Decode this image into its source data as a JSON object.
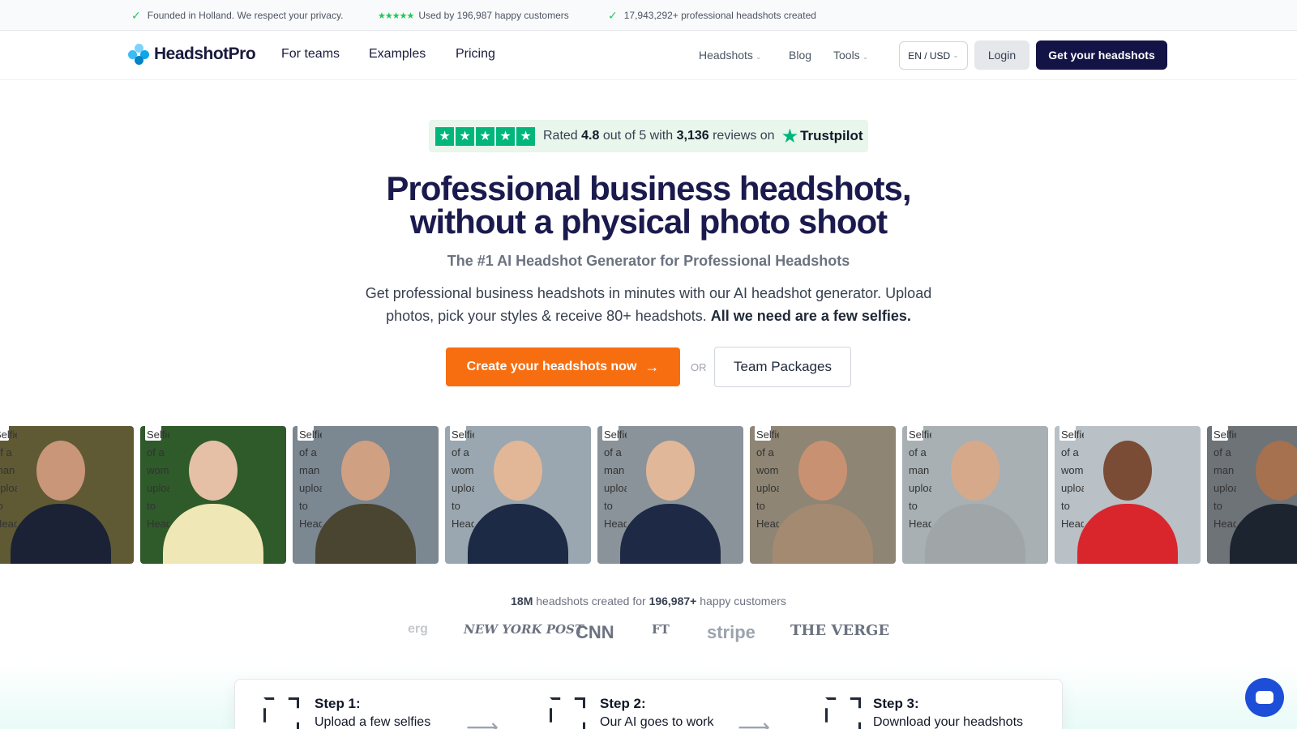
{
  "topbar": {
    "items": [
      "Founded in Holland. We respect your privacy.",
      "Used by 196,987 happy customers",
      "17,943,292+ professional headshots created"
    ]
  },
  "nav": {
    "brand": "HeadshotPro",
    "links": [
      "For teams",
      "Examples",
      "Pricing"
    ],
    "secondary": [
      "Headshots",
      "Blog",
      "Tools"
    ],
    "lang": "EN / USD",
    "login": "Login",
    "cta": "Get your headshots"
  },
  "trust": {
    "rated": "Rated",
    "score": "4.8",
    "out_of": "out of 5 with",
    "reviews": "3,136",
    "reviews_on": "reviews on",
    "brand": "Trustpilot"
  },
  "hero": {
    "title_line1": "Professional business headshots,",
    "title_line2": "without a physical photo shoot",
    "subtitle": "The #1 AI Headshot Generator for Professional Headshots",
    "desc_main": "Get professional business headshots in minutes with our AI headshot generator. Upload photos, pick your styles & receive 80+ headshots.",
    "desc_bold": "All we need are a few selfies.",
    "create_btn": "Create your headshots now",
    "or": "OR",
    "team_btn": "Team Packages"
  },
  "gallery_alts": [
    "Selfie of a man uploaded to Headshot",
    "Selfie of a woman uploaded to Headshot",
    "Selfie of a man uploaded to Headshot",
    "Selfie of a woman uploaded to Headshot",
    "Selfie of a man uploaded to Headshot",
    "Selfie of a woman uploaded to Headshot",
    "Selfie of a man uploaded to Headshot",
    "Selfie of a woman uploaded to Headshot",
    "Selfie of a man uploaded to Headshot"
  ],
  "stats": {
    "count": "18M",
    "mid": "headshots created for",
    "customers": "196,987+",
    "tail": "happy customers"
  },
  "press": [
    "erg",
    "NEW YORK POST",
    "CNN",
    "FT",
    "stripe",
    "THE VERGE"
  ],
  "steps": [
    {
      "title": "Step 1:",
      "desc": "Upload a few selfies"
    },
    {
      "title": "Step 2:",
      "desc": "Our AI goes to work"
    },
    {
      "title": "Step 3:",
      "desc": "Download your headshots"
    }
  ],
  "colors": {
    "brand_dark": "#131346",
    "cta_orange": "#f76e11",
    "trust_green": "#00b67a"
  }
}
